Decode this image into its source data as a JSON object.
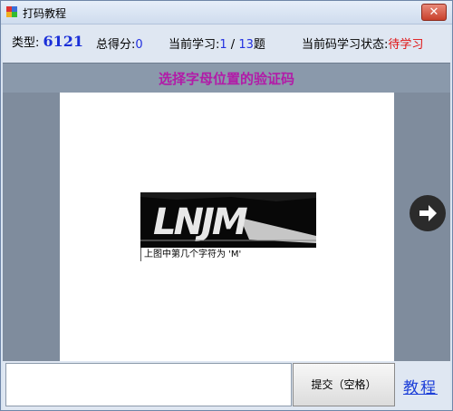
{
  "window": {
    "title": "打码教程",
    "close_glyph": "✕"
  },
  "stats": {
    "type_label": "类型:",
    "type_value": "6121",
    "score_label": "总得分:",
    "score_value": "0",
    "progress_label": "当前学习:",
    "progress_current": "1",
    "progress_sep": " / ",
    "progress_total": "13",
    "progress_suffix": "题",
    "status_label": "当前码学习状态:",
    "status_value": "待学习"
  },
  "banner": {
    "text": "选择字母位置的验证码"
  },
  "captcha": {
    "image_text": "LNJM",
    "caption": "上图中第几个字符为 'M'"
  },
  "controls": {
    "next_icon": "right-arrow-icon",
    "answer_value": "",
    "submit_label": "提交（空格）",
    "tutorial_label": "教程"
  },
  "colors": {
    "accent_blue": "#1a2fd8",
    "status_red": "#e01010",
    "banner_text": "#b21ba8",
    "panel_gray": "#7f8c9d"
  }
}
